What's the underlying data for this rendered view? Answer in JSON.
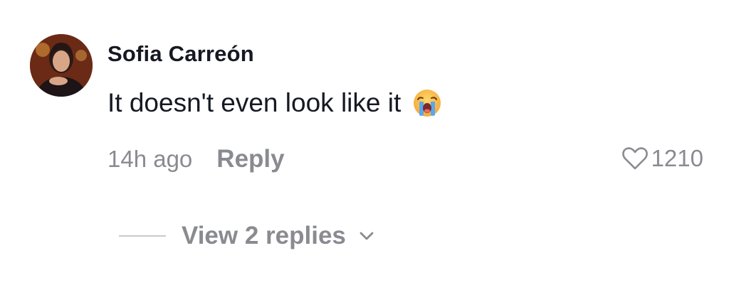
{
  "comment": {
    "username": "Sofia Carreón",
    "text": "It doesn't even look like it",
    "emoji": "loudly-crying-face-icon",
    "timestamp": "14h ago",
    "reply_label": "Reply",
    "like_count": "1210",
    "view_replies_label": "View 2 replies"
  },
  "colors": {
    "primary_text": "#161823",
    "secondary_text": "#8a8b91",
    "background": "#ffffff"
  }
}
